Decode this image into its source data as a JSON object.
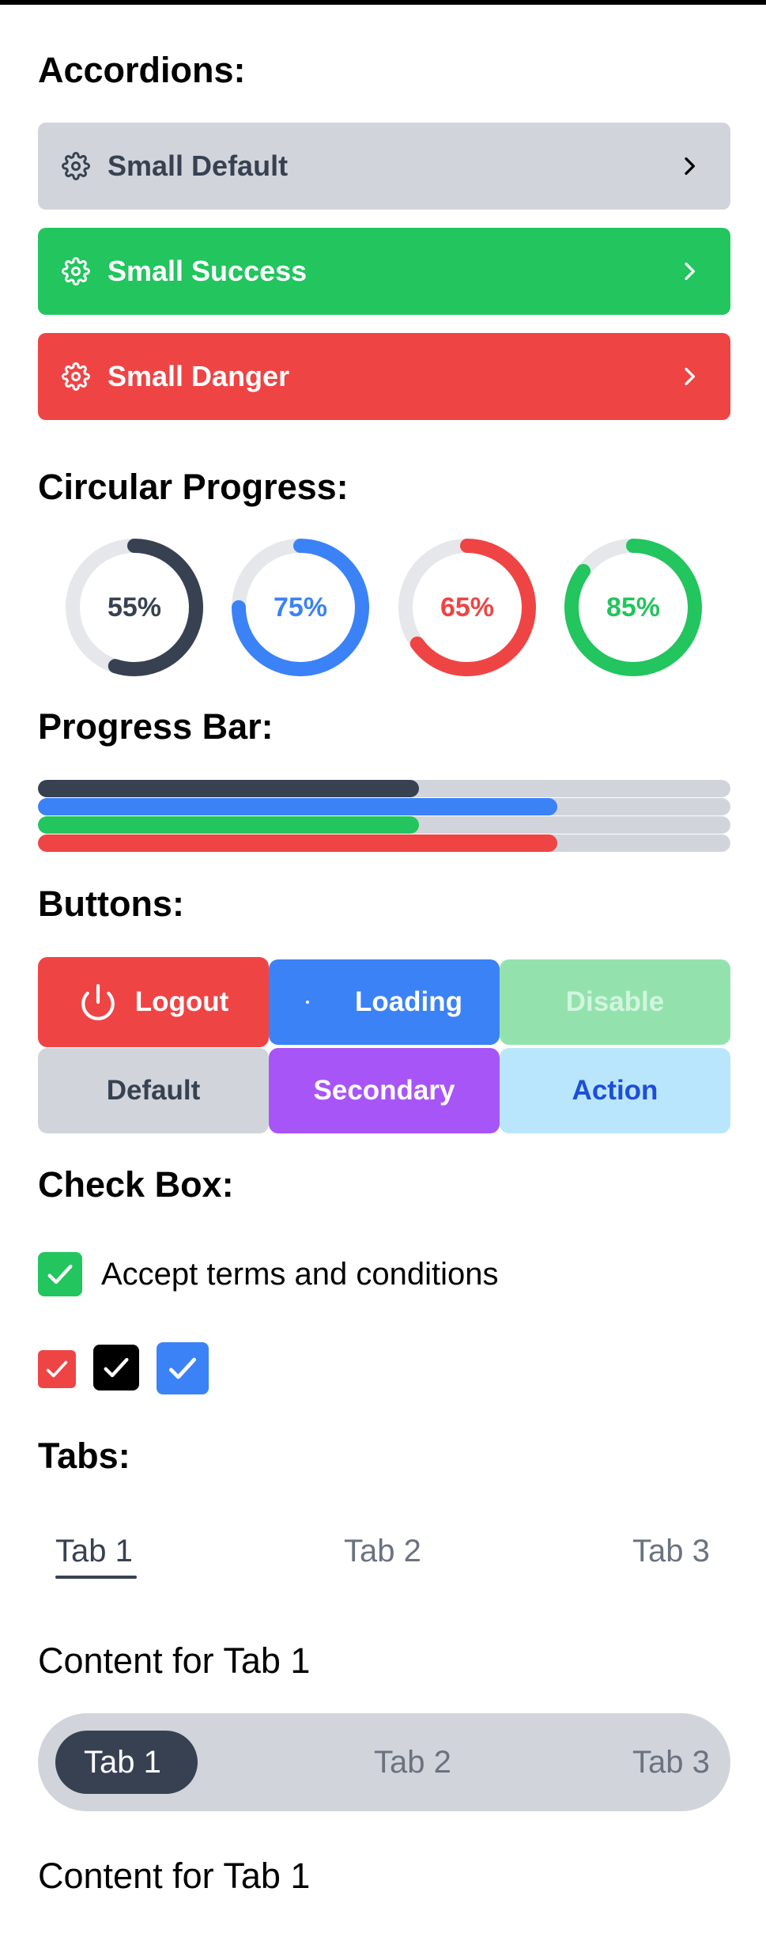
{
  "headings": {
    "accordions": "Accordions:",
    "circular": "Circular Progress:",
    "progress": "Progress Bar:",
    "buttons": "Buttons:",
    "checkbox": "Check Box:",
    "tabs": "Tabs:"
  },
  "accordions": [
    {
      "label": "Small Default",
      "variant": "default",
      "bg": "#d1d5db",
      "fg": "#374151"
    },
    {
      "label": "Small Success",
      "variant": "success",
      "bg": "#22c55e",
      "fg": "#ffffff"
    },
    {
      "label": "Small Danger",
      "variant": "danger",
      "bg": "#ef4444",
      "fg": "#ffffff"
    }
  ],
  "circular_progress": [
    {
      "label": "55%",
      "value": 0.55,
      "color": "#374151"
    },
    {
      "label": "75%",
      "value": 0.75,
      "color": "#3b82f6"
    },
    {
      "label": "65%",
      "value": 0.65,
      "color": "#ef4444"
    },
    {
      "label": "85%",
      "value": 0.85,
      "color": "#22c55e"
    }
  ],
  "progress_bars": [
    {
      "value": 0.55,
      "color": "#374151"
    },
    {
      "value": 0.75,
      "color": "#3b82f6"
    },
    {
      "value": 0.55,
      "color": "#22c55e"
    },
    {
      "value": 0.75,
      "color": "#ef4444"
    }
  ],
  "buttons": {
    "logout": {
      "label": "Logout",
      "icon": "power-icon",
      "bg": "#ef4444"
    },
    "loading": {
      "label": "Loading",
      "icon": "spinner-icon",
      "bg": "#3b82f6"
    },
    "disable": {
      "label": "Disable",
      "bg": "#93e2ae"
    },
    "default": {
      "label": "Default",
      "bg": "#d1d5db"
    },
    "secondary": {
      "label": "Secondary",
      "bg": "#a855f7"
    },
    "action": {
      "label": "Action",
      "bg": "#bae6fd"
    }
  },
  "checkbox": {
    "label": "Accept terms and conditions",
    "checked": true,
    "color": "#22c55e",
    "extra": [
      {
        "color": "#ef4444",
        "checked": true
      },
      {
        "color": "#000000",
        "checked": true
      },
      {
        "color": "#3b82f6",
        "checked": true
      }
    ]
  },
  "tabs": {
    "items": [
      "Tab 1",
      "Tab 2",
      "Tab 3"
    ],
    "active": "Tab 1",
    "content": "Content for Tab 1"
  },
  "pill_tabs": {
    "items": [
      "Tab 1",
      "Tab 2",
      "Tab 3"
    ],
    "active": "Tab 1",
    "content": "Content for Tab 1"
  }
}
